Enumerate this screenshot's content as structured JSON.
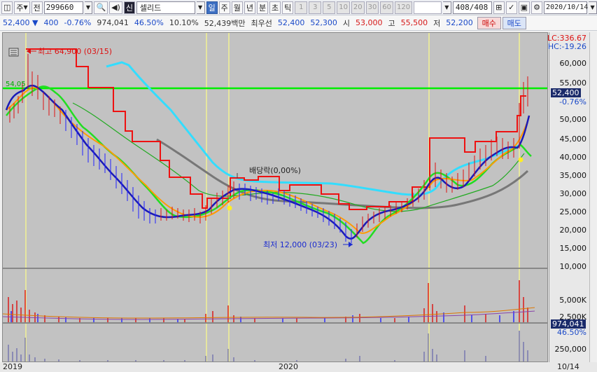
{
  "toolbar": {
    "market_label": "주",
    "prev_label": "전",
    "stock_code": "299660",
    "badge": "신",
    "stock_name": "셀리드",
    "periods": [
      "일",
      "주",
      "월",
      "년",
      "분",
      "초",
      "틱"
    ],
    "intervals": [
      "1",
      "3",
      "5",
      "10",
      "20",
      "30",
      "60",
      "120"
    ],
    "count": "408",
    "count_total": "/408",
    "date": "2020/10/14"
  },
  "quote": {
    "price": "52,400",
    "change": "400",
    "change_pct": "-0.76%",
    "volume": "974,041",
    "vol_ratio": "46.50%",
    "turnover": "10.10%",
    "amount": "52,439백만",
    "best_label": "최우선",
    "ask": "52,400",
    "bid": "52,300",
    "open_label": "시",
    "open": "53,000",
    "high_label": "고",
    "high": "55,500",
    "low_label": "저",
    "low": "52,200",
    "buy_label": "매수",
    "sell_label": "매도"
  },
  "chart": {
    "lc": "LC:336.67",
    "hc": "HC:-19.26",
    "high_note": "최고 64,900 (03/15)",
    "low_note": "최저 12,000 (03/23)",
    "dividend_note": "배당락(0,00%)",
    "hline_value": "54,05",
    "price_ticks": [
      "60,000",
      "55,000",
      "50,000",
      "45,000",
      "40,000",
      "35,000",
      "30,000",
      "25,000",
      "20,000",
      "15,000",
      "10,000"
    ],
    "last_price": "52,400",
    "last_change": "-0.76%",
    "vol_ticks": [
      "5,000K",
      "2,500K"
    ],
    "last_vol": "974,041",
    "last_vol_ratio": "46.50%",
    "vol2_ticks": [
      "250,000"
    ],
    "x_labels": [
      "2019",
      "2020",
      "10/14"
    ],
    "colors": {
      "background": "#c2c2c2",
      "hline": "#00ee00",
      "price_line": "#1a1ab8",
      "ma_short": "#ff9a00",
      "ma_mid": "#00d000",
      "ma_long": "#777777",
      "ichimoku": "#ee1111",
      "cyan_line": "#33ddff"
    }
  }
}
